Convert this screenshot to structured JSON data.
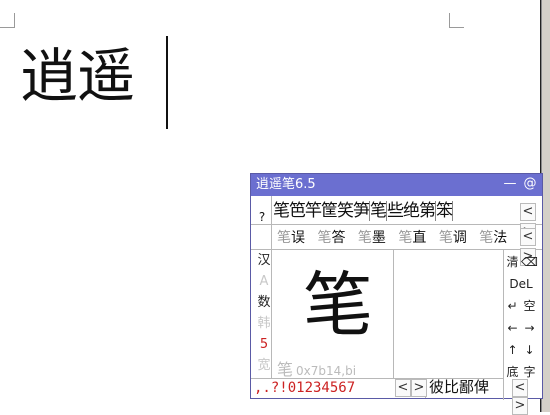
{
  "document": {
    "text": "逍遥"
  },
  "ime": {
    "title": "逍遥笔6.5",
    "minimize_label": "—",
    "about_label": "@",
    "prompt_mark": "?",
    "candidates_row1": [
      "笔",
      "笆",
      "竿",
      "筐",
      "笑",
      "笋",
      "笔",
      "些",
      "绝",
      "第",
      "笨"
    ],
    "phrases": [
      {
        "prefix": "笔",
        "word": "误"
      },
      {
        "prefix": "笔",
        "word": "答"
      },
      {
        "prefix": "笔",
        "word": "墨"
      },
      {
        "prefix": "笔",
        "word": "直"
      },
      {
        "prefix": "笔",
        "word": "调"
      },
      {
        "prefix": "笔",
        "word": "法"
      }
    ],
    "nav_prev": "<",
    "nav_next": ">",
    "mode_keys": [
      "汉",
      "A",
      "数",
      "韩",
      "5",
      "宽"
    ],
    "recognized_char": "笔",
    "code_char": "笔",
    "code_text": "0x7b14,bi",
    "right_keys": [
      [
        "清",
        "⌫"
      ],
      [
        "DeL",
        ""
      ],
      [
        "↵",
        "空"
      ],
      [
        "←",
        "→"
      ],
      [
        "↑",
        "↓"
      ],
      [
        "底",
        "字"
      ]
    ],
    "punct": ",.?!01234567",
    "assoc": "彼比鄙俾"
  }
}
